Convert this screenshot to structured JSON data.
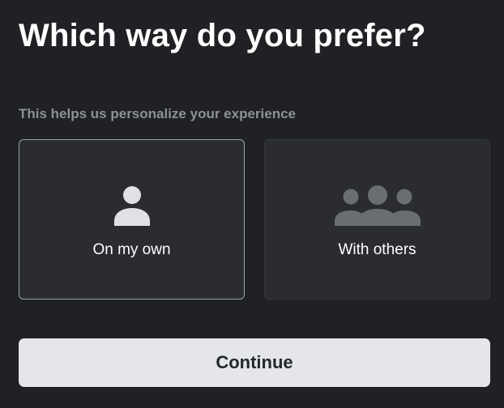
{
  "title": "Which way do you prefer?",
  "subtitle": "This helps us personalize your experience",
  "options": [
    {
      "label": "On my own",
      "icon": "person-icon",
      "icon_color": "#dfe1e4",
      "selected": true
    },
    {
      "label": "With others",
      "icon": "group-icon",
      "icon_color": "#6a6d71",
      "selected": false
    }
  ],
  "continue_label": "Continue",
  "colors": {
    "background": "#1f2124",
    "card_background": "#2a2c30",
    "selected_border": "#9ea2a7",
    "button_background": "#e4e6e9",
    "button_text": "#24272b",
    "subtitle_text": "#8e9194"
  }
}
